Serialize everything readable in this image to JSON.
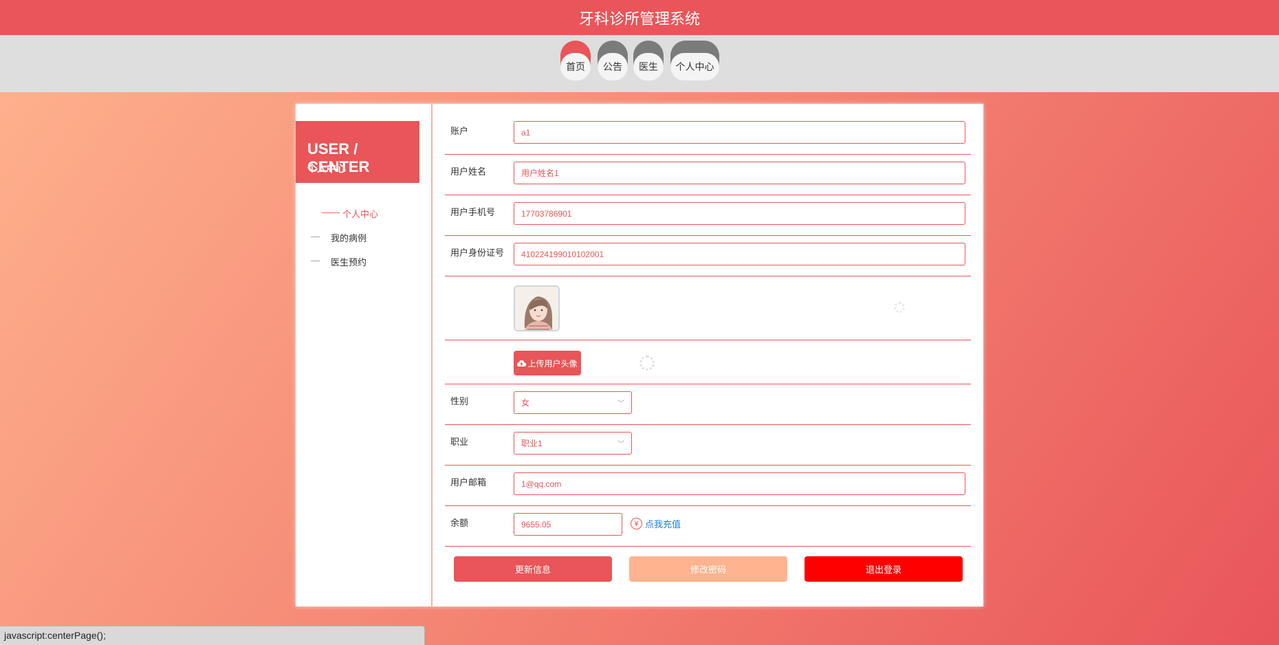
{
  "app": {
    "title": "牙科诊所管理系统"
  },
  "nav": {
    "items": [
      {
        "label": "首页",
        "active": true
      },
      {
        "label": "公告",
        "active": false
      },
      {
        "label": "医生",
        "active": false
      },
      {
        "label": "个人中心",
        "active": false
      }
    ]
  },
  "sidebar": {
    "title_en": "USER / CENTER",
    "title_cn": "个人中心",
    "items": [
      {
        "dash": "——",
        "label": "个人中心",
        "active": true
      },
      {
        "dash": "—",
        "label": "我的病例",
        "active": false
      },
      {
        "dash": "—",
        "label": "医生预约",
        "active": false
      }
    ]
  },
  "form": {
    "account": {
      "label": "账户",
      "value": "a1"
    },
    "username": {
      "label": "用户姓名",
      "value": "用户姓名1"
    },
    "phone": {
      "label": "用户手机号",
      "value": "17703786901"
    },
    "idcard": {
      "label": "用户身份证号",
      "value": "410224199010102001"
    },
    "upload_avatar_label": "上传用户头像",
    "gender": {
      "label": "性别",
      "value": "女"
    },
    "occupation": {
      "label": "职业",
      "value": "职业1"
    },
    "email": {
      "label": "用户邮箱",
      "value": "1@qq.com"
    },
    "balance": {
      "label": "余额",
      "value": "9655.05",
      "recharge_label": "点我充值",
      "recharge_icon": "¥"
    }
  },
  "buttons": {
    "update": "更新信息",
    "change_password": "修改密码",
    "logout": "退出登录"
  },
  "statusbar": {
    "text": "javascript:centerPage();"
  },
  "colors": {
    "accent": "#e95558",
    "peach": "#ffb38e",
    "logout": "#ff0000",
    "link": "#1b7fd8"
  }
}
